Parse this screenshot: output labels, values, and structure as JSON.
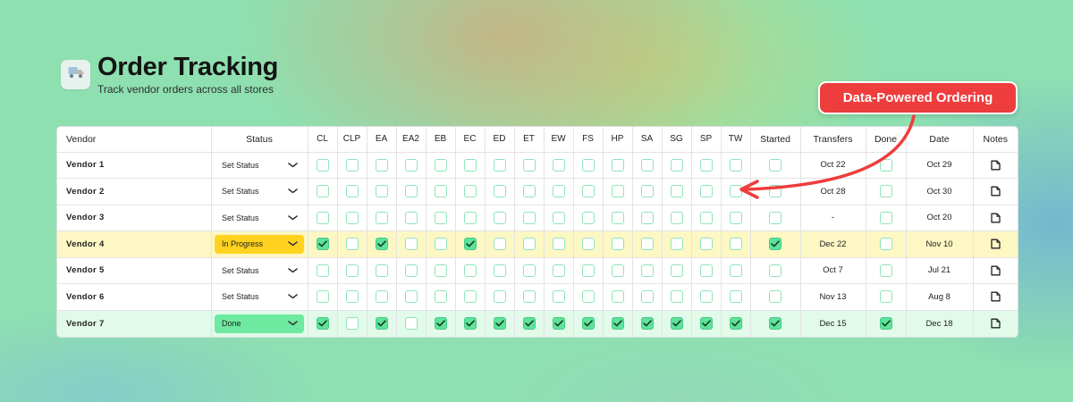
{
  "header": {
    "title": "Order Tracking",
    "subtitle": "Track vendor orders across all stores",
    "icon": "truck-icon"
  },
  "callout": {
    "label": "Data-Powered Ordering",
    "color": "#ee3d3d"
  },
  "table": {
    "columns": {
      "vendor": "Vendor",
      "status": "Status",
      "stores": [
        "CL",
        "CLP",
        "EA",
        "EA2",
        "EB",
        "EC",
        "ED",
        "ET",
        "EW",
        "FS",
        "HP",
        "SA",
        "SG",
        "SP",
        "TW"
      ],
      "started": "Started",
      "transfers": "Transfers",
      "done": "Done",
      "date": "Date",
      "notes": "Notes"
    },
    "rows": [
      {
        "vendor": "Vendor 1",
        "status": "Set Status",
        "status_type": "default",
        "stores": [
          0,
          0,
          0,
          0,
          0,
          0,
          0,
          0,
          0,
          0,
          0,
          0,
          0,
          0,
          0
        ],
        "started": 0,
        "transfers": "Oct 22",
        "done": 0,
        "date": "Oct 29"
      },
      {
        "vendor": "Vendor 2",
        "status": "Set Status",
        "status_type": "default",
        "stores": [
          0,
          0,
          0,
          0,
          0,
          0,
          0,
          0,
          0,
          0,
          0,
          0,
          0,
          0,
          0
        ],
        "started": 0,
        "transfers": "Oct 28",
        "done": 0,
        "date": "Oct 30"
      },
      {
        "vendor": "Vendor 3",
        "status": "Set Status",
        "status_type": "default",
        "stores": [
          0,
          0,
          0,
          0,
          0,
          0,
          0,
          0,
          0,
          0,
          0,
          0,
          0,
          0,
          0
        ],
        "started": 0,
        "transfers": "-",
        "done": 0,
        "date": "Oct 20"
      },
      {
        "vendor": "Vendor 4",
        "status": "In Progress",
        "status_type": "progress",
        "stores": [
          1,
          0,
          1,
          0,
          0,
          1,
          0,
          0,
          0,
          0,
          0,
          0,
          0,
          0,
          0
        ],
        "started": 1,
        "transfers": "Dec 22",
        "done": 0,
        "date": "Nov 10"
      },
      {
        "vendor": "Vendor 5",
        "status": "Set Status",
        "status_type": "default",
        "stores": [
          0,
          0,
          0,
          0,
          0,
          0,
          0,
          0,
          0,
          0,
          0,
          0,
          0,
          0,
          0
        ],
        "started": 0,
        "transfers": "Oct 7",
        "done": 0,
        "date": "Jul 21"
      },
      {
        "vendor": "Vendor 6",
        "status": "Set Status",
        "status_type": "default",
        "stores": [
          0,
          0,
          0,
          0,
          0,
          0,
          0,
          0,
          0,
          0,
          0,
          0,
          0,
          0,
          0
        ],
        "started": 0,
        "transfers": "Nov 13",
        "done": 0,
        "date": "Aug 8"
      },
      {
        "vendor": "Vendor 7",
        "status": "Done",
        "status_type": "done",
        "stores": [
          1,
          0,
          1,
          0,
          1,
          1,
          1,
          1,
          1,
          1,
          1,
          1,
          1,
          1,
          1
        ],
        "started": 1,
        "transfers": "Dec 15",
        "done": 1,
        "date": "Dec 18"
      }
    ]
  },
  "colors": {
    "in_progress": "#ffd21f",
    "done": "#6eeaa0",
    "checkbox_border": "#8fe4b8",
    "checkbox_checked": "#5ee39a"
  }
}
